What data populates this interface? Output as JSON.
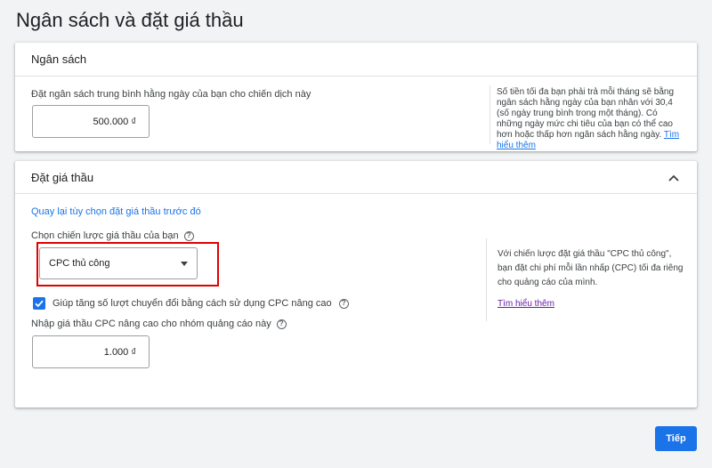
{
  "page": {
    "title": "Ngân sách và đặt giá thầu"
  },
  "budget": {
    "header": "Ngân sách",
    "label": "Đặt ngân sách trung bình hằng ngày của bạn cho chiến dịch này",
    "value": "500.000 ₫",
    "note": "Số tiền tối đa bạn phải trả mỗi tháng sẽ bằng ngân sách hằng ngày của bạn nhân với 30,4 (số ngày trung bình trong một tháng). Có những ngày mức chi tiêu của bạn có thể cao hơn hoặc thấp hơn ngân sách hằng ngày.",
    "learn_more": "Tìm hiểu thêm"
  },
  "bidding": {
    "header": "Đặt giá thầu",
    "back_link": "Quay lại tùy chọn đặt giá thầu trước đó",
    "strategy_label": "Chọn chiến lược giá thầu của bạn",
    "strategy_value": "CPC thủ công",
    "checkbox_label": "Giúp tăng số lượt chuyển đổi bằng cách sử dụng CPC nâng cao",
    "checkbox_checked": true,
    "cpc_label": "Nhập giá thầu CPC nâng cao cho nhóm quảng cáo này",
    "cpc_value": "1.000 ₫",
    "note": "Với chiến lược đặt giá thầu \"CPC thủ công\", bạn đặt chi phí mỗi lần nhấp (CPC) tối đa riêng cho quảng cáo của mình.",
    "learn_more": "Tìm hiểu thêm"
  },
  "footer": {
    "next_label": "Tiếp"
  },
  "colors": {
    "accent": "#1a73e8",
    "highlight": "#e00000",
    "visited_link": "#681da8"
  }
}
